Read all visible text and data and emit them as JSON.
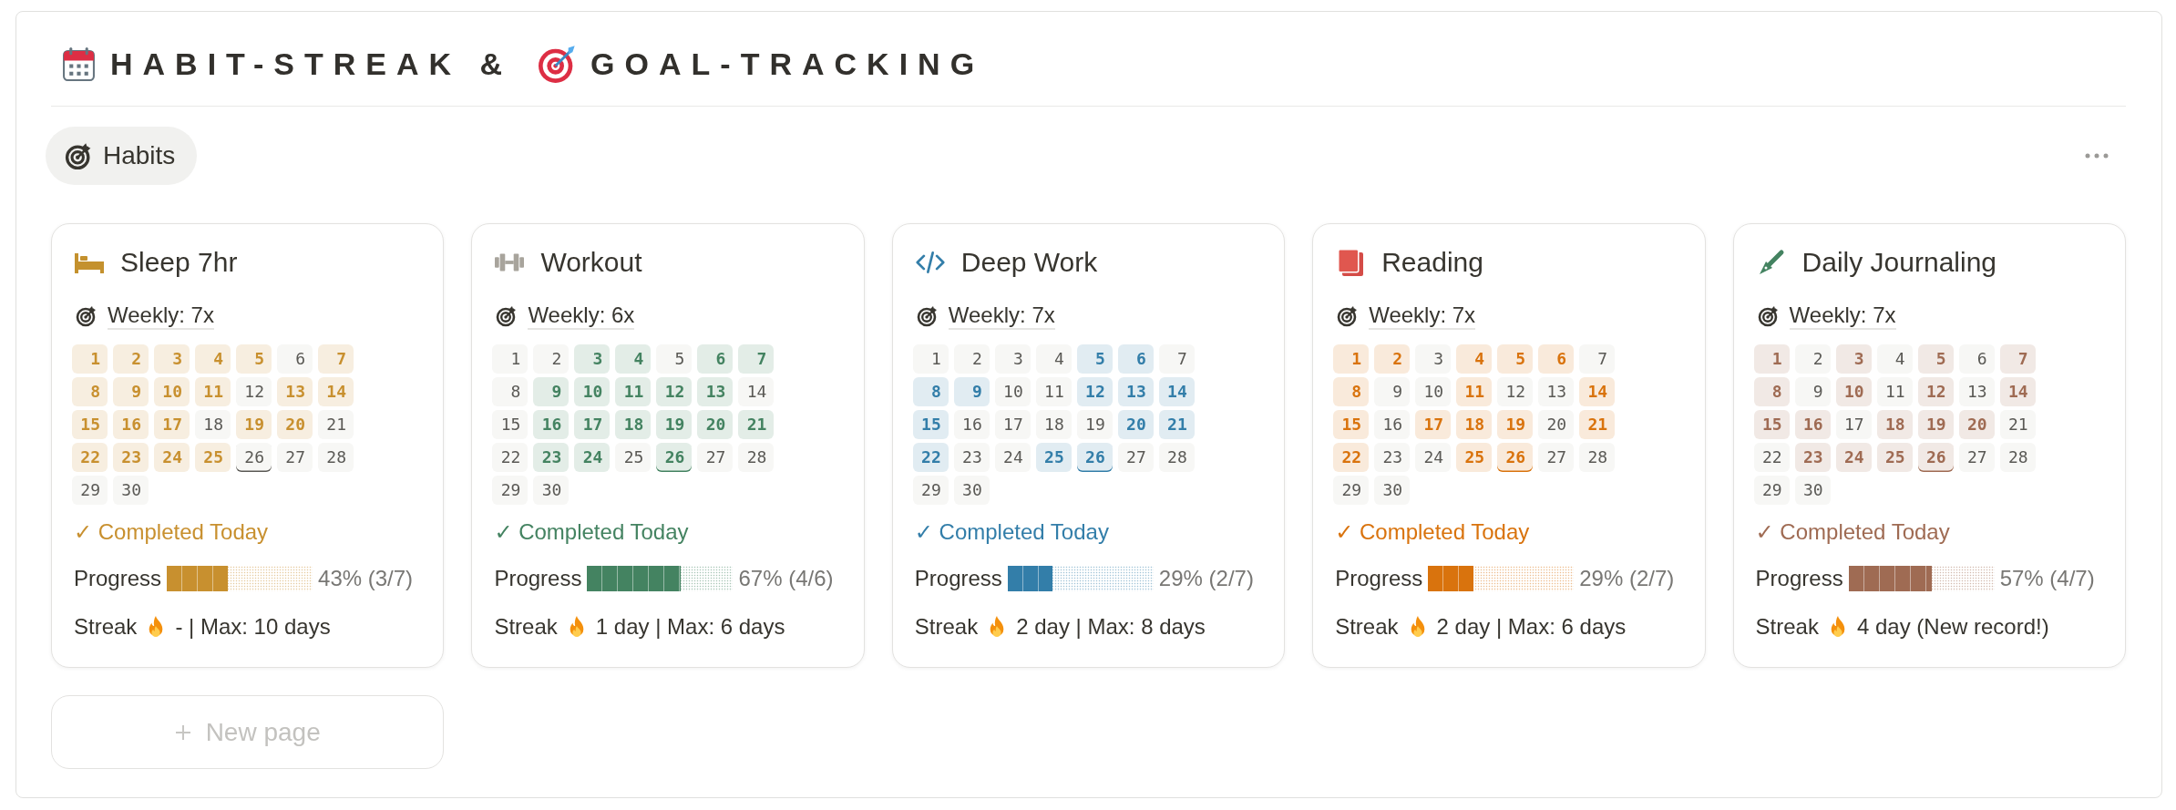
{
  "title": [
    "HABIT-STREAK &",
    "GOAL-TRACKING"
  ],
  "tabs": [
    {
      "label": "Habits",
      "selected": true
    }
  ],
  "habits": [
    {
      "kind": "sleep",
      "name": "Sleep 7hr",
      "color": "#c8902f",
      "goal": "Weekly: 7x",
      "days": [
        {
          "day": "1",
          "done": true,
          "today": false
        },
        {
          "day": "2",
          "done": true,
          "today": false
        },
        {
          "day": "3",
          "done": true,
          "today": false
        },
        {
          "day": "4",
          "done": true,
          "today": false
        },
        {
          "day": "5",
          "done": true,
          "today": false
        },
        {
          "day": "6",
          "done": false,
          "today": false
        },
        {
          "day": "7",
          "done": true,
          "today": false
        },
        {
          "day": "8",
          "done": true,
          "today": false
        },
        {
          "day": "9",
          "done": true,
          "today": false
        },
        {
          "day": "10",
          "done": true,
          "today": false
        },
        {
          "day": "11",
          "done": true,
          "today": false
        },
        {
          "day": "12",
          "done": false,
          "today": false
        },
        {
          "day": "13",
          "done": true,
          "today": false
        },
        {
          "day": "14",
          "done": true,
          "today": false
        },
        {
          "day": "15",
          "done": true,
          "today": false
        },
        {
          "day": "16",
          "done": true,
          "today": false
        },
        {
          "day": "17",
          "done": true,
          "today": false
        },
        {
          "day": "18",
          "done": false,
          "today": false
        },
        {
          "day": "19",
          "done": true,
          "today": false
        },
        {
          "day": "20",
          "done": true,
          "today": false
        },
        {
          "day": "21",
          "done": false,
          "today": false
        },
        {
          "day": "22",
          "done": true,
          "today": false
        },
        {
          "day": "23",
          "done": true,
          "today": false
        },
        {
          "day": "24",
          "done": true,
          "today": false
        },
        {
          "day": "25",
          "done": true,
          "today": false
        },
        {
          "day": "26",
          "done": false,
          "today": true
        },
        {
          "day": "27",
          "done": false,
          "today": false
        },
        {
          "day": "28",
          "done": false,
          "today": false
        },
        {
          "day": "29",
          "done": false,
          "today": false
        },
        {
          "day": "30",
          "done": false,
          "today": false
        }
      ],
      "status": "✓ Completed Today",
      "progress": {
        "label": "Progress",
        "level": 0.42,
        "reading": "43% (3/7)"
      },
      "streak": {
        "label": "Streak",
        "value": "- | Max: 10 days"
      }
    },
    {
      "kind": "workout",
      "name": "Workout",
      "color": "#448361",
      "goal": "Weekly: 6x",
      "days": [
        {
          "day": "1",
          "done": false,
          "today": false
        },
        {
          "day": "2",
          "done": false,
          "today": false
        },
        {
          "day": "3",
          "done": true,
          "today": false
        },
        {
          "day": "4",
          "done": true,
          "today": false
        },
        {
          "day": "5",
          "done": false,
          "today": false
        },
        {
          "day": "6",
          "done": true,
          "today": false
        },
        {
          "day": "7",
          "done": true,
          "today": false
        },
        {
          "day": "8",
          "done": false,
          "today": false
        },
        {
          "day": "9",
          "done": true,
          "today": false
        },
        {
          "day": "10",
          "done": true,
          "today": false
        },
        {
          "day": "11",
          "done": true,
          "today": false
        },
        {
          "day": "12",
          "done": true,
          "today": false
        },
        {
          "day": "13",
          "done": true,
          "today": false
        },
        {
          "day": "14",
          "done": false,
          "today": false
        },
        {
          "day": "15",
          "done": false,
          "today": false
        },
        {
          "day": "16",
          "done": true,
          "today": false
        },
        {
          "day": "17",
          "done": true,
          "today": false
        },
        {
          "day": "18",
          "done": true,
          "today": false
        },
        {
          "day": "19",
          "done": true,
          "today": false
        },
        {
          "day": "20",
          "done": true,
          "today": false
        },
        {
          "day": "21",
          "done": true,
          "today": false
        },
        {
          "day": "22",
          "done": false,
          "today": false
        },
        {
          "day": "23",
          "done": true,
          "today": false
        },
        {
          "day": "24",
          "done": true,
          "today": false
        },
        {
          "day": "25",
          "done": false,
          "today": false
        },
        {
          "day": "26",
          "done": true,
          "today": true
        },
        {
          "day": "27",
          "done": false,
          "today": false
        },
        {
          "day": "28",
          "done": false,
          "today": false
        },
        {
          "day": "29",
          "done": false,
          "today": false
        },
        {
          "day": "30",
          "done": false,
          "today": false
        }
      ],
      "status": "✓ Completed Today",
      "progress": {
        "label": "Progress",
        "level": 0.64,
        "reading": "67% (4/6)"
      },
      "streak": {
        "label": "Streak",
        "value": "1 day | Max: 6 days"
      }
    },
    {
      "kind": "deepwork",
      "name": "Deep Work",
      "color": "#337ea9",
      "goal": "Weekly: 7x",
      "days": [
        {
          "day": "1",
          "done": false,
          "today": false
        },
        {
          "day": "2",
          "done": false,
          "today": false
        },
        {
          "day": "3",
          "done": false,
          "today": false
        },
        {
          "day": "4",
          "done": false,
          "today": false
        },
        {
          "day": "5",
          "done": true,
          "today": false
        },
        {
          "day": "6",
          "done": true,
          "today": false
        },
        {
          "day": "7",
          "done": false,
          "today": false
        },
        {
          "day": "8",
          "done": true,
          "today": false
        },
        {
          "day": "9",
          "done": true,
          "today": false
        },
        {
          "day": "10",
          "done": false,
          "today": false
        },
        {
          "day": "11",
          "done": false,
          "today": false
        },
        {
          "day": "12",
          "done": true,
          "today": false
        },
        {
          "day": "13",
          "done": true,
          "today": false
        },
        {
          "day": "14",
          "done": true,
          "today": false
        },
        {
          "day": "15",
          "done": true,
          "today": false
        },
        {
          "day": "16",
          "done": false,
          "today": false
        },
        {
          "day": "17",
          "done": false,
          "today": false
        },
        {
          "day": "18",
          "done": false,
          "today": false
        },
        {
          "day": "19",
          "done": false,
          "today": false
        },
        {
          "day": "20",
          "done": true,
          "today": false
        },
        {
          "day": "21",
          "done": true,
          "today": false
        },
        {
          "day": "22",
          "done": true,
          "today": false
        },
        {
          "day": "23",
          "done": false,
          "today": false
        },
        {
          "day": "24",
          "done": false,
          "today": false
        },
        {
          "day": "25",
          "done": true,
          "today": false
        },
        {
          "day": "26",
          "done": true,
          "today": true
        },
        {
          "day": "27",
          "done": false,
          "today": false
        },
        {
          "day": "28",
          "done": false,
          "today": false
        },
        {
          "day": "29",
          "done": false,
          "today": false
        },
        {
          "day": "30",
          "done": false,
          "today": false
        }
      ],
      "status": "✓ Completed Today",
      "progress": {
        "label": "Progress",
        "level": 0.31,
        "reading": "29% (2/7)"
      },
      "streak": {
        "label": "Streak",
        "value": "2 day | Max: 8 days"
      }
    },
    {
      "kind": "reading",
      "name": "Reading",
      "color": "#d9730d",
      "goal": "Weekly: 7x",
      "days": [
        {
          "day": "1",
          "done": true,
          "today": false
        },
        {
          "day": "2",
          "done": true,
          "today": false
        },
        {
          "day": "3",
          "done": false,
          "today": false
        },
        {
          "day": "4",
          "done": true,
          "today": false
        },
        {
          "day": "5",
          "done": true,
          "today": false
        },
        {
          "day": "6",
          "done": true,
          "today": false
        },
        {
          "day": "7",
          "done": false,
          "today": false
        },
        {
          "day": "8",
          "done": true,
          "today": false
        },
        {
          "day": "9",
          "done": false,
          "today": false
        },
        {
          "day": "10",
          "done": false,
          "today": false
        },
        {
          "day": "11",
          "done": true,
          "today": false
        },
        {
          "day": "12",
          "done": false,
          "today": false
        },
        {
          "day": "13",
          "done": false,
          "today": false
        },
        {
          "day": "14",
          "done": true,
          "today": false
        },
        {
          "day": "15",
          "done": true,
          "today": false
        },
        {
          "day": "16",
          "done": false,
          "today": false
        },
        {
          "day": "17",
          "done": true,
          "today": false
        },
        {
          "day": "18",
          "done": true,
          "today": false
        },
        {
          "day": "19",
          "done": true,
          "today": false
        },
        {
          "day": "20",
          "done": false,
          "today": false
        },
        {
          "day": "21",
          "done": true,
          "today": false
        },
        {
          "day": "22",
          "done": true,
          "today": false
        },
        {
          "day": "23",
          "done": false,
          "today": false
        },
        {
          "day": "24",
          "done": false,
          "today": false
        },
        {
          "day": "25",
          "done": true,
          "today": false
        },
        {
          "day": "26",
          "done": true,
          "today": true
        },
        {
          "day": "27",
          "done": false,
          "today": false
        },
        {
          "day": "28",
          "done": false,
          "today": false
        },
        {
          "day": "29",
          "done": false,
          "today": false
        },
        {
          "day": "30",
          "done": false,
          "today": false
        }
      ],
      "status": "✓ Completed Today",
      "progress": {
        "label": "Progress",
        "level": 0.31,
        "reading": "29% (2/7)"
      },
      "streak": {
        "label": "Streak",
        "value": "2 day | Max: 6 days"
      }
    },
    {
      "kind": "journaling",
      "name": "Daily Journaling",
      "color": "#9f6b53",
      "goal": "Weekly: 7x",
      "days": [
        {
          "day": "1",
          "done": true,
          "today": false
        },
        {
          "day": "2",
          "done": false,
          "today": false
        },
        {
          "day": "3",
          "done": true,
          "today": false
        },
        {
          "day": "4",
          "done": false,
          "today": false
        },
        {
          "day": "5",
          "done": true,
          "today": false
        },
        {
          "day": "6",
          "done": false,
          "today": false
        },
        {
          "day": "7",
          "done": true,
          "today": false
        },
        {
          "day": "8",
          "done": true,
          "today": false
        },
        {
          "day": "9",
          "done": false,
          "today": false
        },
        {
          "day": "10",
          "done": true,
          "today": false
        },
        {
          "day": "11",
          "done": false,
          "today": false
        },
        {
          "day": "12",
          "done": true,
          "today": false
        },
        {
          "day": "13",
          "done": false,
          "today": false
        },
        {
          "day": "14",
          "done": true,
          "today": false
        },
        {
          "day": "15",
          "done": true,
          "today": false
        },
        {
          "day": "16",
          "done": true,
          "today": false
        },
        {
          "day": "17",
          "done": false,
          "today": false
        },
        {
          "day": "18",
          "done": true,
          "today": false
        },
        {
          "day": "19",
          "done": true,
          "today": false
        },
        {
          "day": "20",
          "done": true,
          "today": false
        },
        {
          "day": "21",
          "done": false,
          "today": false
        },
        {
          "day": "22",
          "done": false,
          "today": false
        },
        {
          "day": "23",
          "done": true,
          "today": false
        },
        {
          "day": "24",
          "done": true,
          "today": false
        },
        {
          "day": "25",
          "done": true,
          "today": false
        },
        {
          "day": "26",
          "done": true,
          "today": true
        },
        {
          "day": "27",
          "done": false,
          "today": false
        },
        {
          "day": "28",
          "done": false,
          "today": false
        },
        {
          "day": "29",
          "done": false,
          "today": false
        },
        {
          "day": "30",
          "done": false,
          "today": false
        }
      ],
      "status": "✓ Completed Today",
      "progress": {
        "label": "Progress",
        "level": 0.57,
        "reading": "57% (4/7)"
      },
      "streak": {
        "label": "Streak",
        "value": "4 day (New record!)"
      }
    }
  ],
  "new_page_button": {
    "label": "New page"
  }
}
